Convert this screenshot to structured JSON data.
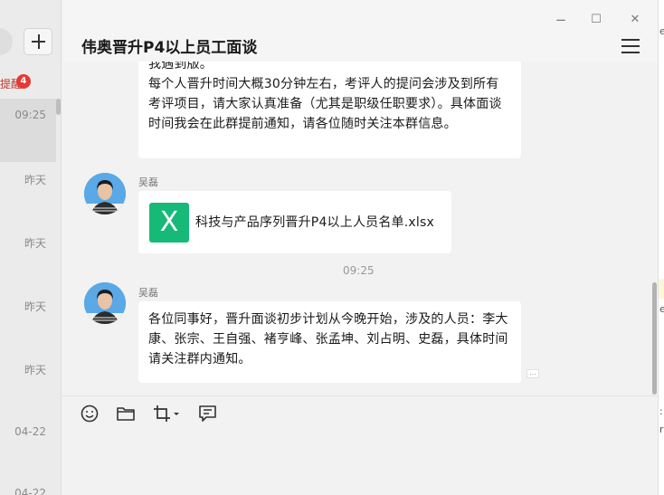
{
  "sidebar": {
    "reminder_fragment": "提醒",
    "badge_count": "4",
    "times": [
      "09:25",
      "昨天",
      "昨天",
      "昨天",
      "昨天",
      "04-22",
      "04-22"
    ]
  },
  "window": {
    "title": "伟奥晋升P4以上员工面谈",
    "minimize": "−",
    "maximize": "☐",
    "close": "✕"
  },
  "messages": {
    "first": {
      "cut_top": "我遇到版。",
      "text": "每个人晋升时间大概30分钟左右，考评人的提问会涉及到所有考评项目，请大家认真准备（尤其是职级任职要求）。具体面谈时间我会在此群提前通知，请各位随时关注本群信息。"
    },
    "file_message": {
      "sender": "吴磊",
      "icon_letter": "X",
      "file_name": "科技与产品序列晋升P4以上人员名单.xlsx"
    },
    "time_separator": "09:25",
    "last": {
      "sender": "吴磊",
      "text": "各位同事好，晋升面谈初步计划从今晚开始，涉及的人员：李大康、张宗、王自强、褚亨峰、张孟坤、刘占明、史磊，具体时间请关注群内通知。",
      "more": "..."
    }
  },
  "toolbar": {
    "icons": [
      "emoji-icon",
      "folder-icon",
      "screenshot-icon",
      "chat-history-icon"
    ]
  },
  "right_edge": {
    "fragments": [
      "e",
      "e",
      ":",
      "r"
    ]
  },
  "colors": {
    "accent_badge": "#e53935",
    "xlsx_green": "#17b978",
    "bubble": "#ffffff",
    "avatar_bg": "#5aa9e6"
  }
}
